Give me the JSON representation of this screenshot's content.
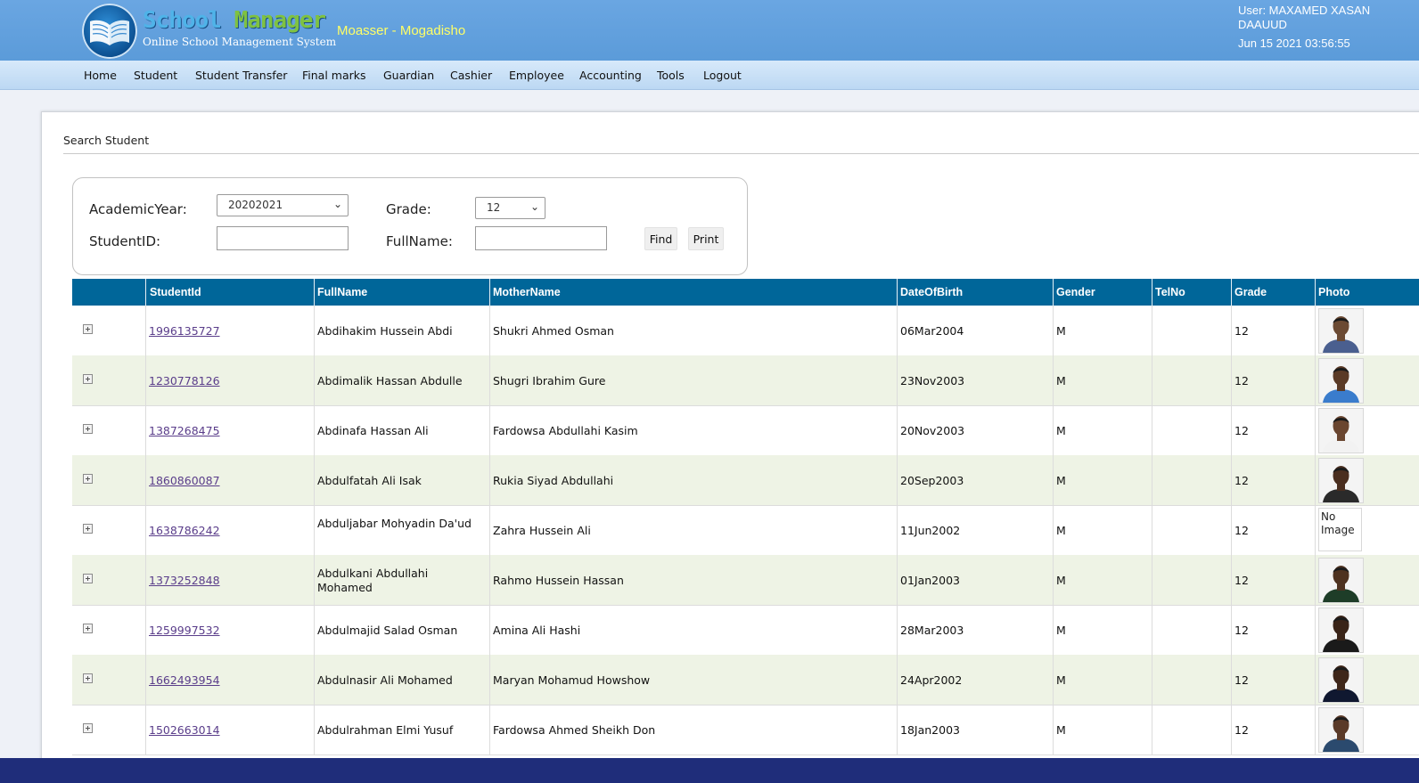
{
  "header": {
    "brand_word1": "School",
    "brand_word2": "Manager",
    "brand_tagline": "Online School Management System",
    "school_name": "Moasser - Mogadisho",
    "user_line": "User: MAXAMED XASAN DAAUUD",
    "datetime": "Jun 15 2021 03:56:55"
  },
  "nav": [
    "Home",
    "Student",
    "Student Transfer",
    "Final marks",
    "Guardian",
    "Cashier",
    "Employee",
    "Accounting",
    "Tools",
    "Logout"
  ],
  "page": {
    "title": "Search Student"
  },
  "search": {
    "academic_year_label": "AcademicYear:",
    "academic_year_value": "20202021",
    "grade_label": "Grade:",
    "grade_value": "12",
    "student_id_label": "StudentID:",
    "student_id_value": "",
    "fullname_label": "FullName:",
    "fullname_value": "",
    "find_label": "Find",
    "print_label": "Print"
  },
  "table": {
    "headers": [
      "StudentId",
      "FullName",
      "MotherName",
      "DateOfBirth",
      "Gender",
      "TelNo",
      "Grade",
      "Photo"
    ],
    "rows": [
      {
        "id": "1996135727",
        "full": "Abdihakim Hussein Abdi",
        "mother": "Shukri Ahmed Osman",
        "dob": "06Mar2004",
        "gender": "M",
        "tel": "",
        "grade": "12",
        "photo": "photo",
        "skin": "#6b4a33",
        "shirt": "#4a5f8f"
      },
      {
        "id": "1230778126",
        "full": "Abdimalik Hassan Abdulle",
        "mother": "Shugri Ibrahim Gure",
        "dob": "23Nov2003",
        "gender": "M",
        "tel": "",
        "grade": "12",
        "photo": "photo",
        "skin": "#5a3a26",
        "shirt": "#3a7ccc"
      },
      {
        "id": "1387268475",
        "full": "Abdinafa Hassan Ali",
        "mother": "Fardowsa Abdullahi Kasim",
        "dob": "20Nov2003",
        "gender": "M",
        "tel": "",
        "grade": "12",
        "photo": "photo",
        "skin": "#6a4630",
        "shirt": "#f2f2f2"
      },
      {
        "id": "1860860087",
        "full": "Abdulfatah Ali Isak",
        "mother": "Rukia Siyad Abdullahi",
        "dob": "20Sep2003",
        "gender": "M",
        "tel": "",
        "grade": "12",
        "photo": "photo",
        "skin": "#4a2e1f",
        "shirt": "#2a2a2a"
      },
      {
        "id": "1638786242",
        "full": "Abduljabar Mohyadin Da'ud",
        "mother": "Zahra Hussein Ali",
        "dob": "11Jun2002",
        "gender": "M",
        "tel": "",
        "grade": "12",
        "photo": "noimage",
        "no_image_text": "No Image",
        "skin": "",
        "shirt": ""
      },
      {
        "id": "1373252848",
        "full": "Abdulkani Abdullahi Mohamed",
        "mother": "Rahmo Hussein Hassan",
        "dob": "01Jan2003",
        "gender": "M",
        "tel": "",
        "grade": "12",
        "photo": "photo",
        "skin": "#4e3220",
        "shirt": "#1e3d28"
      },
      {
        "id": "1259997532",
        "full": "Abdulmajid Salad Osman",
        "mother": "Amina Ali Hashi",
        "dob": "28Mar2003",
        "gender": "M",
        "tel": "",
        "grade": "12",
        "photo": "photo",
        "skin": "#3a2418",
        "shirt": "#1a1a1a"
      },
      {
        "id": "1662493954",
        "full": "Abdulnasir Ali Mohamed",
        "mother": "Maryan Mohamud Howshow",
        "dob": "24Apr2002",
        "gender": "M",
        "tel": "",
        "grade": "12",
        "photo": "photo",
        "skin": "#3e2619",
        "shirt": "#101830"
      },
      {
        "id": "1502663014",
        "full": "Abdulrahman Elmi Yusuf",
        "mother": "Fardowsa Ahmed Sheikh Don",
        "dob": "18Jan2003",
        "gender": "M",
        "tel": "",
        "grade": "12",
        "photo": "photo",
        "skin": "#5a3a28",
        "shirt": "#2b4a6e"
      }
    ]
  },
  "colors": {
    "header_bg": "#5b9bd9",
    "table_header_bg": "#006699",
    "alt_row_bg": "#eef3e5",
    "school_name": "#ffff66",
    "link": "#5a3d8a"
  }
}
